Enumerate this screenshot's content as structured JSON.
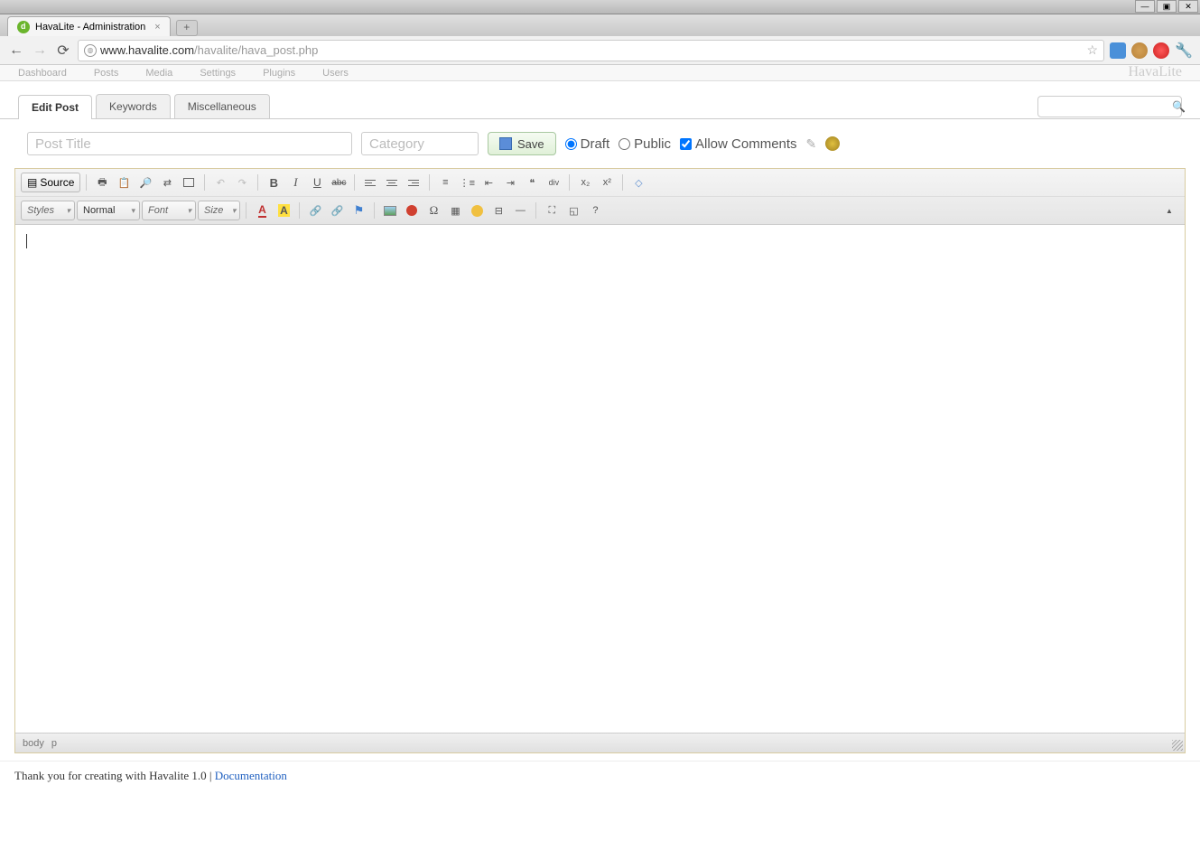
{
  "window": {
    "title": "HavaLite - Administration"
  },
  "browser": {
    "url_host": "www.havalite.com",
    "url_path": "/havalite/hava_post.php"
  },
  "admin_nav": {
    "items": [
      "Dashboard",
      "Posts",
      "Media",
      "Settings",
      "Plugins",
      "Users"
    ],
    "brand": "HavaLite"
  },
  "page_tabs": {
    "items": [
      "Edit Post",
      "Keywords",
      "Miscellaneous"
    ],
    "active": 0
  },
  "form": {
    "title_placeholder": "Post Title",
    "category_placeholder": "Category",
    "save_label": "Save",
    "draft_label": "Draft",
    "public_label": "Public",
    "allow_comments_label": "Allow Comments",
    "draft_checked": true,
    "public_checked": false,
    "allow_comments_checked": true
  },
  "editor": {
    "source_label": "Source",
    "styles_label": "Styles",
    "format_label": "Normal",
    "font_label": "Font",
    "size_label": "Size",
    "status_path": [
      "body",
      "p"
    ]
  },
  "footer": {
    "text_prefix": "Thank you for creating with Havalite 1.0 | ",
    "doc_link": "Documentation"
  }
}
